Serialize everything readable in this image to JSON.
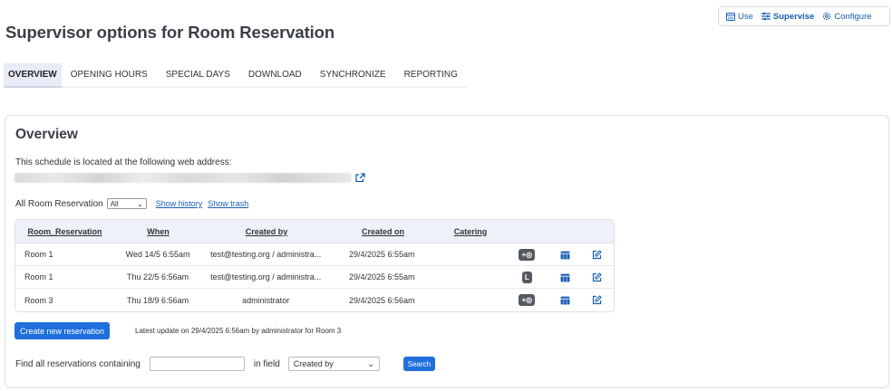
{
  "topnav": {
    "use_label": "Use",
    "supervise_label": "Supervise",
    "configure_label": "Configure"
  },
  "page_title": "Supervisor options for Room Reservation",
  "tabs": [
    {
      "label": "OVERVIEW",
      "active": true
    },
    {
      "label": "OPENING HOURS"
    },
    {
      "label": "SPECIAL DAYS"
    },
    {
      "label": "DOWNLOAD"
    },
    {
      "label": "SYNCHRONIZE"
    },
    {
      "label": "REPORTING"
    }
  ],
  "overview": {
    "title": "Overview",
    "web_address_text": "This schedule is located at the following web address:",
    "filter_label": "All Room Reservation",
    "filter_select_value": "All",
    "show_history": "Show history",
    "show_trash": "Show trash"
  },
  "table": {
    "headers": [
      "Room_Reservation",
      "When",
      "Created by",
      "Created on",
      "Catering"
    ],
    "rows": [
      {
        "room": "Room 1",
        "when": "Wed 14/5 6:55am",
        "created_by": "test@testing.org / administra...",
        "created_on": "29/4/2025 6:55am",
        "catering": "",
        "badge": "+◎"
      },
      {
        "room": "Room 1",
        "when": "Thu 22/5 6:56am",
        "created_by": "test@testing.org / administra...",
        "created_on": "29/4/2025 6:55am",
        "catering": "",
        "badge": "L"
      },
      {
        "room": "Room 3",
        "when": "Thu 18/9 6:56am",
        "created_by": "administrator",
        "created_on": "29/4/2025 6:56am",
        "catering": "",
        "badge": "+◎"
      }
    ]
  },
  "create_button": "Create new reservation",
  "latest_update": "Latest update on 29/4/2025 6:56am by administrator for Room 3",
  "search": {
    "label": "Find all reservations containing",
    "input_value": "",
    "in_field": "in field",
    "field_value": "Created by",
    "button": "Search"
  }
}
